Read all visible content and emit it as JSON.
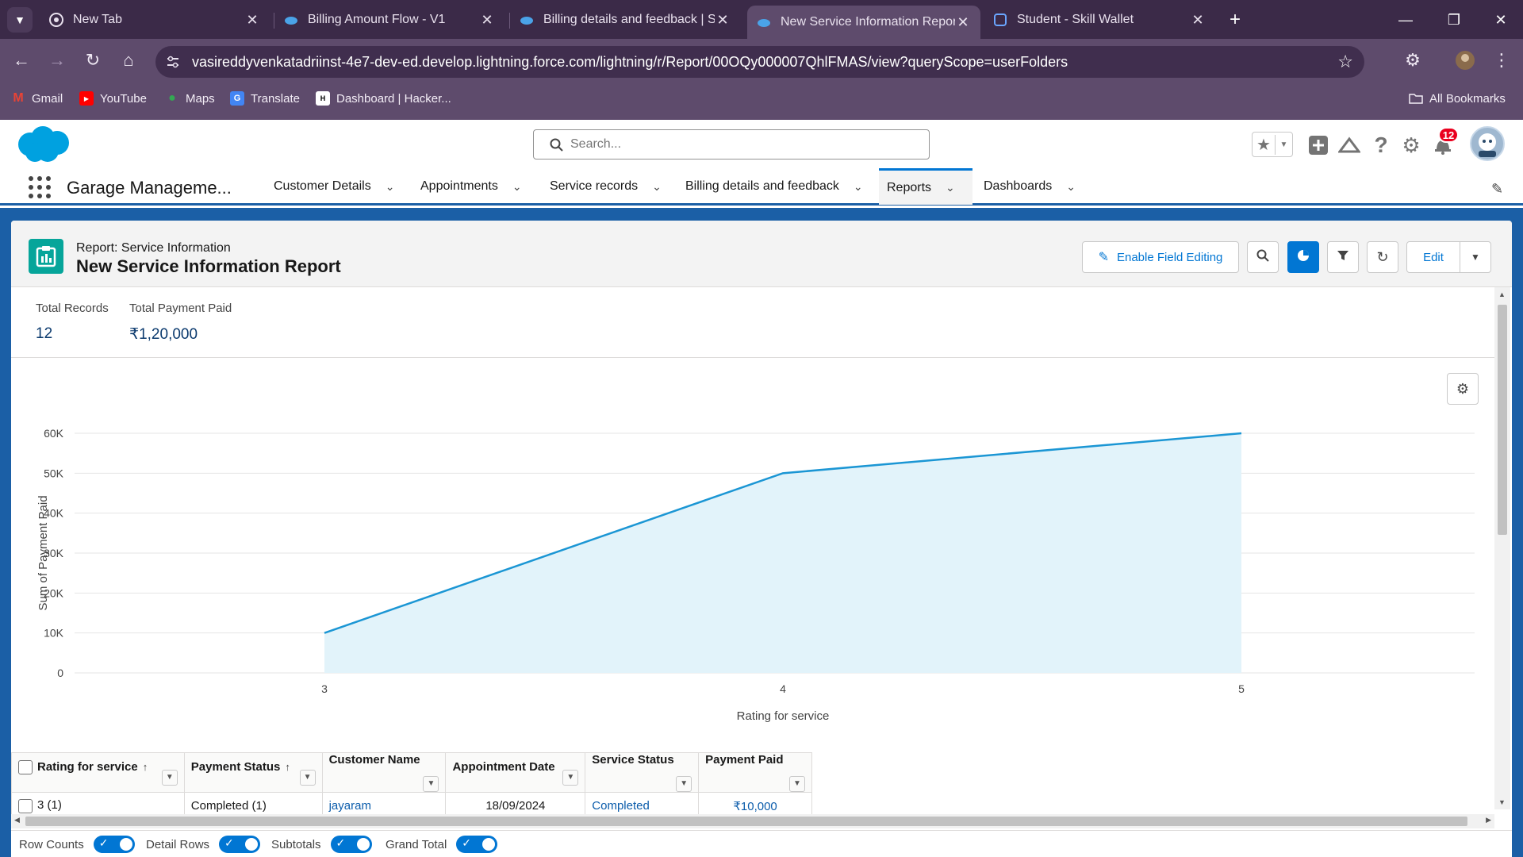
{
  "browser": {
    "tabs": [
      {
        "title": "New Tab",
        "icon": "chrome-icon"
      },
      {
        "title": "Billing Amount Flow - V1",
        "icon": "salesforce-cloud-icon"
      },
      {
        "title": "Billing details and feedback | Sa",
        "icon": "salesforce-cloud-icon"
      },
      {
        "title": "New Service Information Repor",
        "icon": "salesforce-cloud-icon",
        "active": true
      },
      {
        "title": "Student - Skill Wallet",
        "icon": "skill-wallet-icon"
      }
    ],
    "url": "vasireddyvenkatadriinst-4e7-dev-ed.develop.lightning.force.com/lightning/r/Report/00OQy000007QhlFMAS/view?queryScope=userFolders",
    "bookmarks": [
      {
        "label": "Gmail",
        "icon": "gmail-icon"
      },
      {
        "label": "YouTube",
        "icon": "youtube-icon"
      },
      {
        "label": "Maps",
        "icon": "maps-icon"
      },
      {
        "label": "Translate",
        "icon": "translate-icon"
      },
      {
        "label": "Dashboard | Hacker...",
        "icon": "hackerrank-icon"
      }
    ],
    "all_bookmarks": "All Bookmarks"
  },
  "sf": {
    "search_placeholder": "Search...",
    "notification_count": "12",
    "app_name": "Garage Manageme...",
    "nav": [
      {
        "label": "Customer Details"
      },
      {
        "label": "Appointments"
      },
      {
        "label": "Service records"
      },
      {
        "label": "Billing details and feedback"
      },
      {
        "label": "Reports",
        "active": true
      },
      {
        "label": "Dashboards"
      }
    ]
  },
  "report": {
    "type_label": "Report: Service Information",
    "title": "New Service Information Report",
    "enable_field_editing": "Enable Field Editing",
    "edit": "Edit",
    "summary": [
      {
        "label": "Total Records",
        "value": "12"
      },
      {
        "label": "Total Payment Paid",
        "value": "₹1,20,000"
      }
    ]
  },
  "chart_data": {
    "type": "area",
    "x": [
      "3",
      "4",
      "5"
    ],
    "values": [
      10000,
      50000,
      60000
    ],
    "xlabel": "Rating for service",
    "ylabel": "Sum of Payment Paid",
    "yticks": [
      "0",
      "10K",
      "20K",
      "30K",
      "40K",
      "50K",
      "60K"
    ],
    "ylim": [
      0,
      60000
    ],
    "grid": true,
    "line_color": "#1b96d4",
    "fill_color": "#e2f3fa"
  },
  "table": {
    "columns": [
      "Rating for service",
      "Payment Status",
      "Customer Name",
      "Appointment Date",
      "Service Status",
      "Payment Paid"
    ],
    "rows": [
      [
        "3 (1)",
        "Completed (1)",
        "jayaram",
        "18/09/2024",
        "Completed",
        "₹10,000"
      ]
    ]
  },
  "footer": {
    "toggles": [
      {
        "label": "Row Counts",
        "on": true
      },
      {
        "label": "Detail Rows",
        "on": true
      },
      {
        "label": "Subtotals",
        "on": true
      },
      {
        "label": "Grand Total",
        "on": true
      }
    ]
  }
}
